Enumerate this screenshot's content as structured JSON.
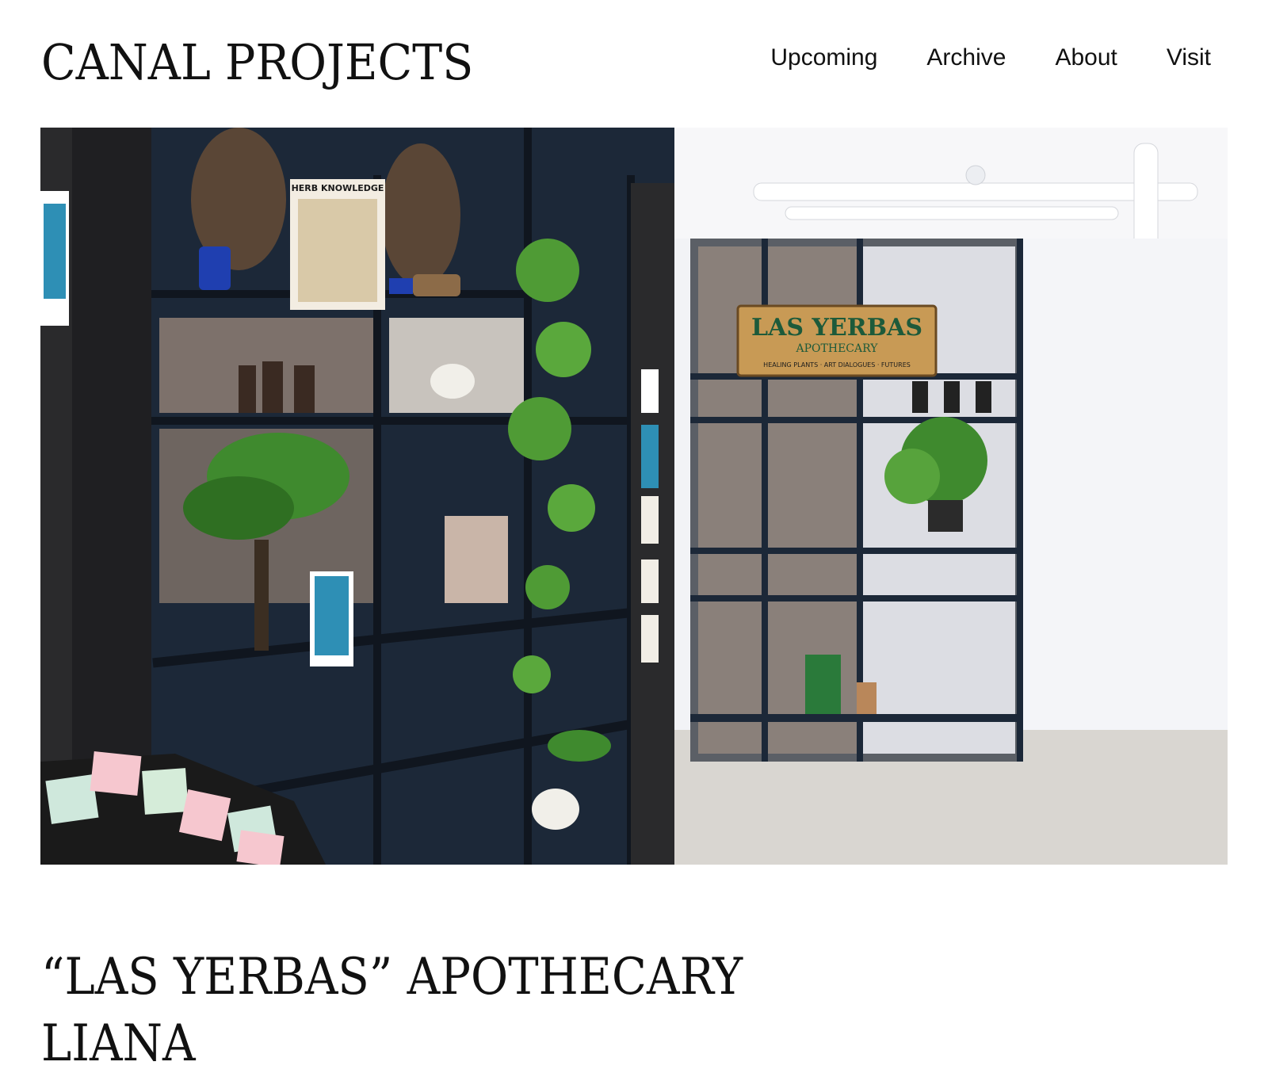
{
  "header": {
    "logo_text": "CANAL PROJECTS"
  },
  "nav": {
    "items": [
      {
        "label": "Upcoming"
      },
      {
        "label": "Archive"
      },
      {
        "label": "About"
      },
      {
        "label": "Visit"
      }
    ]
  },
  "hero": {
    "sign_line1": "LAS YERBAS",
    "sign_line2": "APOTHECARY",
    "sign_line3": "HEALING PLANTS · ART DIALOGUES · FUTURES",
    "poster_title": "HERB KNOWLEDGE",
    "colors": {
      "shelf": "#1c2838",
      "wall": "#f2f3f6",
      "floor": "#d9d6d1",
      "sign_bg": "#c89a55",
      "sign_text": "#1d5a3a",
      "leaf": "#3f8a2e"
    }
  },
  "exhibition": {
    "title_line1": "“LAS YERBAS” APOTHECARY",
    "title_line2": "LIANA"
  }
}
